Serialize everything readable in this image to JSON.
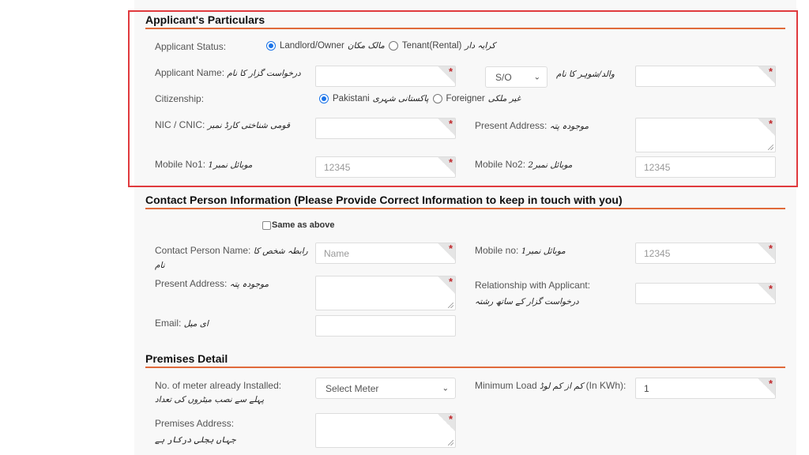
{
  "sections": {
    "applicant": {
      "title": "Applicant's Particulars",
      "status_label": "Applicant Status:",
      "status_options": [
        {
          "label": "Landlord/Owner",
          "urdu": "مالک مکان",
          "selected": true
        },
        {
          "label": "Tenant(Rental)",
          "urdu": "کرایہ دار",
          "selected": false
        }
      ],
      "name_label": "Applicant Name:",
      "name_urdu": "درخواست گزار کا نام",
      "name_value": "",
      "relation_select": "S/O",
      "father_urdu": "والد/شوہر کا نام",
      "father_value": "",
      "citizenship_label": "Citizenship:",
      "citizenship_options": [
        {
          "label": "Pakistani",
          "urdu": "پاکستانی شہری",
          "selected": true
        },
        {
          "label": "Foreigner",
          "urdu": "غیر ملکی",
          "selected": false
        }
      ],
      "cnic_label": "NIC / CNIC:",
      "cnic_urdu": "قومی شناختی کارڈ نمبر",
      "cnic_value": "",
      "address_label": "Present Address:",
      "address_urdu": "موجودہ پتہ",
      "address_value": "",
      "mobile1_label": "Mobile No1:",
      "mobile1_urdu": "موبائل نمبر1",
      "mobile1_placeholder": "12345",
      "mobile2_label": "Mobile No2:",
      "mobile2_urdu": "موبائل نمبر2",
      "mobile2_placeholder": "12345"
    },
    "contact": {
      "title": "Contact Person Information (Please Provide Correct Information to keep in touch with you)",
      "same_as_above_label": "Same as above",
      "same_as_above_checked": false,
      "name_label": "Contact Person Name:",
      "name_urdu": "رابطہ شخص کا",
      "name_urdu2": "نام",
      "name_placeholder": "Name",
      "mobile_label": "Mobile no:",
      "mobile_urdu": "موبائل نمبر1",
      "mobile_placeholder": "12345",
      "address_label": "Present Address:",
      "address_urdu": "موجودہ پتہ",
      "relationship_label": "Relationship with Applicant:",
      "relationship_urdu": "درخواست گزار کے ساتھ رشتہ",
      "email_label": "Email:",
      "email_urdu": "ای میل"
    },
    "premises": {
      "title": "Premises Detail",
      "meters_label": "No. of meter already Installed:",
      "meters_urdu": "پہلے سے نصب میٹروں کی تعداد",
      "meters_select": "Select Meter",
      "load_label": "Minimum Load",
      "load_urdu": "کم از کم لوڈ",
      "load_unit": "(In KWh):",
      "load_value": "1",
      "address_label": "Premises Address:",
      "address_urdu": "جہاں بجلی درکار ہے"
    }
  },
  "required_marker": "*",
  "colors": {
    "accent_underline": "#e06a3a",
    "highlight_border": "#e03a3e",
    "required_star": "#c0282c",
    "radio_selected": "#1a73e8"
  }
}
